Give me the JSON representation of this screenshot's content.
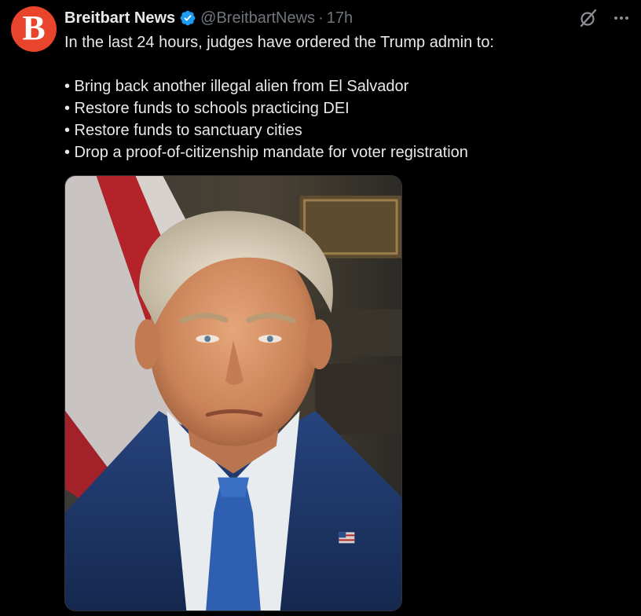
{
  "tweet": {
    "avatar_letter": "B",
    "author_name": "Breitbart News",
    "verified": true,
    "handle": "@BreitbartNews",
    "separator": "·",
    "time": "17h",
    "text_intro": "In the last 24 hours, judges have ordered the Trump admin to:",
    "bullets": [
      "• Bring back another illegal alien from El Salvador",
      "• Restore funds to schools practicing DEI",
      "• Restore funds to sanctuary cities",
      "• Drop a proof-of-citizenship mandate for voter registration"
    ],
    "media": {
      "type": "photo"
    }
  },
  "actions": {
    "grok_icon": "grok-icon",
    "more_icon": "more-options-icon"
  },
  "colors": {
    "background": "#000000",
    "text": "#e7e9ea",
    "secondary_text": "#71767b",
    "verified_blue": "#1d9bf0",
    "brand_red": "#e8452c"
  }
}
